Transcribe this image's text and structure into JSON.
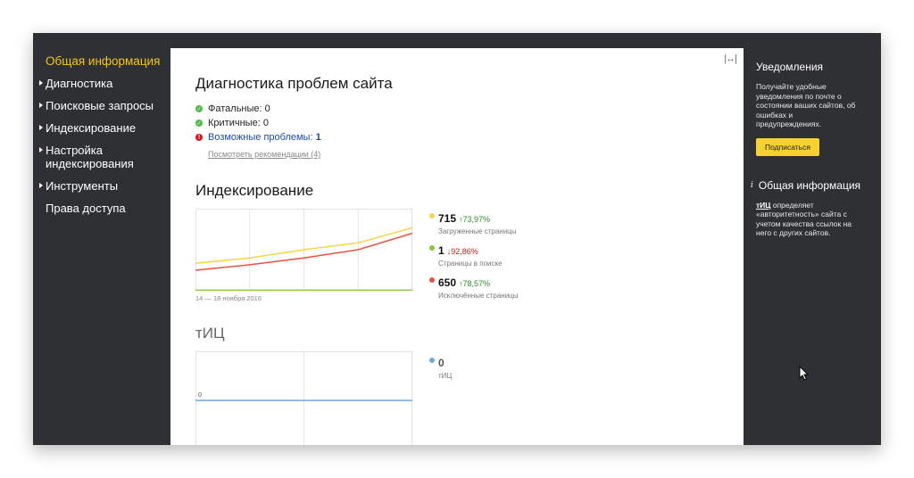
{
  "sidebar": {
    "items": [
      {
        "label": "Общая информация",
        "active": true,
        "arrow": false
      },
      {
        "label": "Диагностика",
        "active": false,
        "arrow": true
      },
      {
        "label": "Поисковые запросы",
        "active": false,
        "arrow": true
      },
      {
        "label": "Индексирование",
        "active": false,
        "arrow": true
      },
      {
        "label": "Настройка индексирования",
        "active": false,
        "arrow": true
      },
      {
        "label": "Инструменты",
        "active": false,
        "arrow": true
      },
      {
        "label": "Права доступа",
        "active": false,
        "arrow": false
      }
    ],
    "active_color": "#f5c518"
  },
  "main": {
    "expand_icon": "expand-horizontal-icon",
    "diagnostics": {
      "title": "Диагностика проблем сайта",
      "fatal_label": "Фатальные:",
      "fatal_count": "0",
      "critical_label": "Критичные:",
      "critical_count": "0",
      "possible_label": "Возможные проблемы:",
      "possible_count": "1",
      "recommendations_link": "Посмотреть рекомендации (4)"
    },
    "indexing": {
      "title": "Индексирование",
      "date_range": "14 — 18 ноября 2016",
      "legend": [
        {
          "value": "715",
          "delta": "↑73,97%",
          "direction": "up",
          "label": "Загруженные страницы",
          "color": "#f7d44a"
        },
        {
          "value": "1",
          "delta": "↓92,86%",
          "direction": "down",
          "label": "Страницы в поиске",
          "color": "#8cc63f"
        },
        {
          "value": "650",
          "delta": "↑78,57%",
          "direction": "up",
          "label": "Исключённые страницы",
          "color": "#e8533f"
        }
      ]
    },
    "tic": {
      "title": "тИЦ",
      "legend": [
        {
          "value": "0",
          "label": "тИЦ",
          "color": "#6fa8dc"
        }
      ]
    }
  },
  "chart_data": [
    {
      "type": "line",
      "x": [
        "14",
        "15",
        "16",
        "17",
        "18"
      ],
      "series": [
        {
          "name": "Загруженные страницы",
          "values": [
            1,
            1.2,
            1.5,
            1.75,
            2.3
          ]
        },
        {
          "name": "Страницы в поиске",
          "values": [
            0.02,
            0.02,
            0.02,
            0.02,
            0.02
          ]
        },
        {
          "name": "Исключённые страницы",
          "values": [
            0.75,
            0.95,
            1.2,
            1.5,
            2.1
          ]
        }
      ],
      "ylim": [
        0,
        3
      ],
      "grid": true,
      "colors": [
        "#f7d44a",
        "#8cc63f",
        "#e8533f"
      ]
    },
    {
      "type": "line",
      "x": [
        "1",
        "2",
        "3"
      ],
      "series": [
        {
          "name": "тИЦ",
          "values": [
            0,
            0,
            0
          ]
        }
      ],
      "ylim": [
        -1,
        1
      ],
      "tick_label": "0",
      "grid": true,
      "colors": [
        "#6fa8dc"
      ]
    }
  ],
  "rightpanel": {
    "notifications_title": "Уведомления",
    "notifications_text": "Получайте удобные уведомления по почте о состоянии ваших сайтов, об ошибках и предупреждениях.",
    "subscribe_button": "Подписаться",
    "info_title": "Общая информация",
    "info_link": "тИЦ",
    "info_text": " определяет «авторитетность» сайта с учетом качества ссылок на него с других сайтов.",
    "button_color": "#f7d12f"
  }
}
